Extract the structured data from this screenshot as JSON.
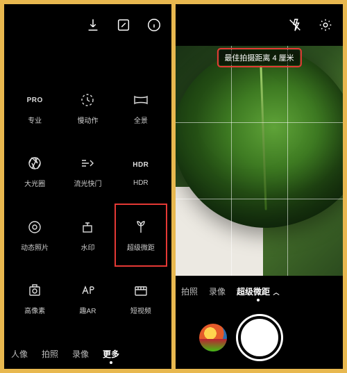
{
  "left": {
    "topbar": [
      "download",
      "edit",
      "info"
    ],
    "modes": [
      {
        "id": "pro",
        "label": "专业",
        "iconText": "PRO"
      },
      {
        "id": "slowmo",
        "label": "慢动作"
      },
      {
        "id": "pano",
        "label": "全景"
      },
      {
        "id": "aperture",
        "label": "大光圈"
      },
      {
        "id": "lightpaint",
        "label": "流光快门"
      },
      {
        "id": "hdr",
        "label": "HDR",
        "iconText": "HDR"
      },
      {
        "id": "moving",
        "label": "动态照片"
      },
      {
        "id": "watermark",
        "label": "水印"
      },
      {
        "id": "macro",
        "label": "超级微距",
        "highlight": true
      },
      {
        "id": "highres",
        "label": "高像素"
      },
      {
        "id": "ar",
        "label": "趣AR"
      },
      {
        "id": "shortvideo",
        "label": "短视频"
      }
    ],
    "tabs": [
      {
        "id": "portrait",
        "label": "人像"
      },
      {
        "id": "photo",
        "label": "拍照"
      },
      {
        "id": "video",
        "label": "录像"
      },
      {
        "id": "more",
        "label": "更多",
        "active": true
      }
    ]
  },
  "right": {
    "topbar": [
      "flash-off",
      "settings"
    ],
    "tip": "最佳拍摄距离 4 厘米",
    "tabs": [
      {
        "id": "photo",
        "label": "拍照"
      },
      {
        "id": "video",
        "label": "录像"
      },
      {
        "id": "macro",
        "label": "超级微距",
        "active": true,
        "chev": true
      }
    ]
  }
}
